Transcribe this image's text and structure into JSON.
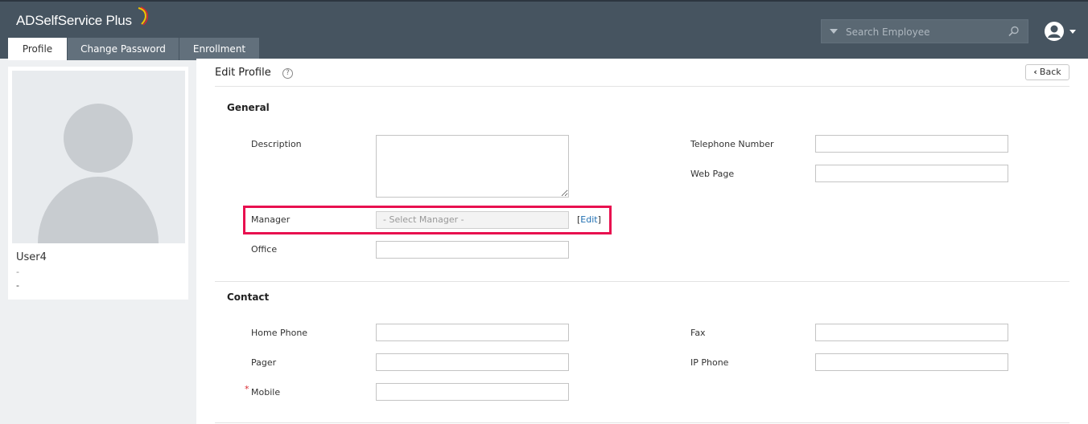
{
  "app": {
    "name": "ADSelfService Plus"
  },
  "tabs": [
    {
      "label": "Profile",
      "active": true
    },
    {
      "label": "Change Password",
      "active": false
    },
    {
      "label": "Enrollment",
      "active": false
    }
  ],
  "search": {
    "placeholder": "Search Employee"
  },
  "user_card": {
    "name": "User4",
    "line1": "-",
    "line2": "-"
  },
  "page": {
    "title": "Edit Profile",
    "back_label": "Back"
  },
  "general": {
    "title": "General",
    "description_label": "Description",
    "manager_label": "Manager",
    "manager_placeholder": "- Select Manager -",
    "edit_label": "Edit",
    "office_label": "Office",
    "telephone_label": "Telephone Number",
    "webpage_label": "Web Page"
  },
  "contact": {
    "title": "Contact",
    "home_phone_label": "Home Phone",
    "pager_label": "Pager",
    "mobile_label": "Mobile",
    "fax_label": "Fax",
    "ip_phone_label": "IP Phone"
  },
  "colors": {
    "header": "#465460",
    "highlight": "#e8104f",
    "link": "#1f6fb2"
  }
}
